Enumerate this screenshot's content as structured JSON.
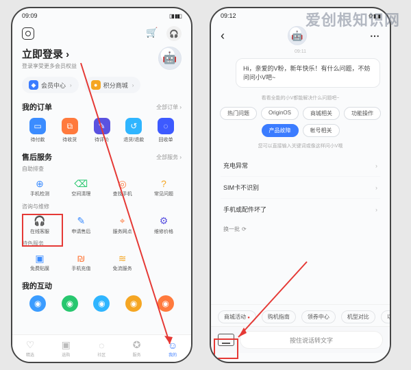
{
  "watermark": "爱创根知识网",
  "left": {
    "status_time": "09:09",
    "login_title": "立即登录 ›",
    "login_sub": "登录享受更多会员权益",
    "pill_member": "会员中心",
    "pill_points": "积分商城",
    "orders_title": "我的订单",
    "orders_more": "全部订单 ›",
    "orders": [
      {
        "label": "待付款",
        "color": "#3b8cff",
        "glyph": "▭"
      },
      {
        "label": "待收货",
        "color": "#ff7a3d",
        "glyph": "⧉"
      },
      {
        "label": "待评价",
        "color": "#5a52e0",
        "glyph": "✎"
      },
      {
        "label": "退货/退款",
        "color": "#2fb5ff",
        "glyph": "↺"
      },
      {
        "label": "回收单",
        "color": "#3d5aff",
        "glyph": "◌"
      }
    ],
    "aftersales_title": "售后服务",
    "aftersales_more": "全部服务 ›",
    "selfcheck_sub": "自助排查",
    "selfcheck": [
      {
        "label": "手机检测",
        "glyph": "⊕",
        "color": "#3b8cff"
      },
      {
        "label": "空间清理",
        "glyph": "⌫",
        "color": "#28c76f"
      },
      {
        "label": "查找手机",
        "glyph": "◎",
        "color": "#ff7a3d"
      },
      {
        "label": "常见问题",
        "glyph": "?",
        "color": "#f5a623"
      }
    ],
    "consult_sub": "咨询与维修",
    "consult": [
      {
        "label": "在线客服",
        "glyph": "🎧",
        "color": "#28c76f"
      },
      {
        "label": "申请售后",
        "glyph": "✎",
        "color": "#3b8cff"
      },
      {
        "label": "服务网点",
        "glyph": "⌖",
        "color": "#ff7a3d"
      },
      {
        "label": "维修价格",
        "glyph": "⚙",
        "color": "#5a52e0"
      }
    ],
    "special_sub": "特色服务",
    "special": [
      {
        "label": "免费贴膜",
        "glyph": "▣",
        "color": "#3b8cff"
      },
      {
        "label": "手机充值",
        "glyph": "₪",
        "color": "#ff7a3d"
      },
      {
        "label": "免流服务",
        "glyph": "≋",
        "color": "#f5a623"
      }
    ],
    "interact_title": "我的互动",
    "interact_colors": [
      "#3b9cff",
      "#28c76f",
      "#2fb5ff",
      "#f5a623",
      "#ff7a3d"
    ],
    "bottom_nav": [
      {
        "label": "精选",
        "glyph": "♡"
      },
      {
        "label": "选购",
        "glyph": "▣"
      },
      {
        "label": "社区",
        "glyph": "◌"
      },
      {
        "label": "服务",
        "glyph": "✪"
      },
      {
        "label": "我的",
        "glyph": "☺"
      }
    ]
  },
  "right": {
    "status_time": "09:12",
    "timestamp": "09:11",
    "greeting": "Hi，亲爱的V粉，新年快乐！有什么问题，不妨问问小V吧~",
    "note1": "看看全能的小V都能解决什么问题吧~",
    "chips": [
      {
        "label": "热门问题",
        "active": false
      },
      {
        "label": "OriginOS",
        "active": false
      },
      {
        "label": "商城相关",
        "active": false
      },
      {
        "label": "功能操作",
        "active": false
      },
      {
        "label": "产品故障",
        "active": true
      },
      {
        "label": "帐号相关",
        "active": false
      }
    ],
    "note2": "您可以直接输入关键词或像这样问小V哦",
    "questions": [
      "充电异常",
      "SIM卡不识别",
      "手机或配件坏了"
    ],
    "refresh": "换一批",
    "hscroll": [
      "商城活动",
      "购机指南",
      "领券中心",
      "机型对比",
      "以"
    ],
    "voice_placeholder": "按住说话转文字"
  }
}
